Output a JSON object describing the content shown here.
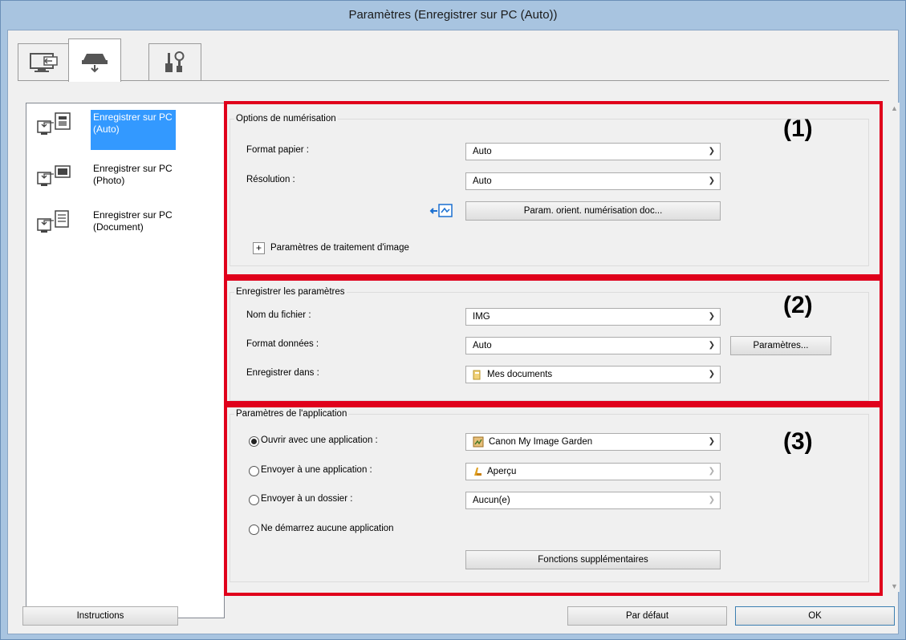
{
  "window": {
    "title": "Paramètres (Enregistrer sur PC (Auto))"
  },
  "tabs": [
    {
      "icon": "scan-from-computer-icon",
      "active": false
    },
    {
      "icon": "scan-from-panel-icon",
      "active": true
    },
    {
      "icon": "general-settings-icon",
      "active": false
    }
  ],
  "left_list": [
    {
      "label": "Enregistrer sur PC (Auto)",
      "selected": true
    },
    {
      "label": "Enregistrer sur PC (Photo)",
      "selected": false
    },
    {
      "label": "Enregistrer sur PC (Document)",
      "selected": false
    }
  ],
  "scan_options": {
    "title": "Options de numérisation",
    "paper_size_label": "Format papier :",
    "paper_size_value": "Auto",
    "resolution_label": "Résolution :",
    "resolution_value": "Auto",
    "orientation_button": "Param. orient. numérisation doc...",
    "image_processing_label": "Paramètres de traitement d'image",
    "expand_glyph": "+",
    "callout": "(1)"
  },
  "save_settings": {
    "title": "Enregistrer les paramètres",
    "file_name_label": "Nom du fichier :",
    "file_name_value": "IMG",
    "data_format_label": "Format données :",
    "data_format_value": "Auto",
    "settings_button": "Paramètres...",
    "save_in_label": "Enregistrer dans :",
    "save_in_value": "Mes documents",
    "callout": "(2)"
  },
  "app_settings": {
    "title": "Paramètres de l'application",
    "open_app_label": "Ouvrir avec une application :",
    "open_app_value": "Canon My Image Garden",
    "send_app_label": "Envoyer à une application :",
    "send_app_value": "Aperçu",
    "send_folder_label": "Envoyer à un dossier :",
    "send_folder_value": "Aucun(e)",
    "no_app_label": "Ne démarrez aucune application",
    "more_functions_button": "Fonctions supplémentaires",
    "selected_radio": "open_app",
    "callout": "(3)"
  },
  "footer": {
    "instructions_button": "Instructions",
    "defaults_button": "Par défaut",
    "ok_button": "OK"
  },
  "colors": {
    "title_bar": "#a8c4e0",
    "highlight": "#e0001b",
    "selection": "#3399ff"
  }
}
